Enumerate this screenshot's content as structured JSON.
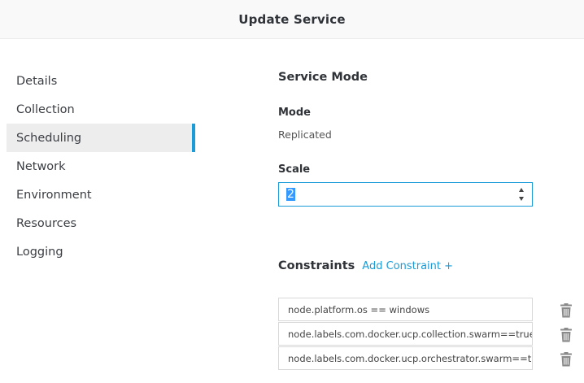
{
  "header": {
    "title": "Update Service"
  },
  "sidebar": {
    "items": [
      {
        "label": "Details"
      },
      {
        "label": "Collection"
      },
      {
        "label": "Scheduling",
        "active": true
      },
      {
        "label": "Network"
      },
      {
        "label": "Environment"
      },
      {
        "label": "Resources"
      },
      {
        "label": "Logging"
      }
    ]
  },
  "service_mode": {
    "title": "Service Mode",
    "mode_label": "Mode",
    "mode_value": "Replicated",
    "scale_label": "Scale",
    "scale_value": "2"
  },
  "constraints": {
    "title": "Constraints",
    "add_label": "Add Constraint +",
    "items": [
      "node.platform.os == windows",
      "node.labels.com.docker.ucp.collection.swarm==true",
      "node.labels.com.docker.ucp.orchestrator.swarm==true"
    ],
    "delete_icon": "trash-icon"
  },
  "colors": {
    "accent": "#1b9bd7",
    "active_bg": "#ededee",
    "selection": "#3399ff"
  }
}
